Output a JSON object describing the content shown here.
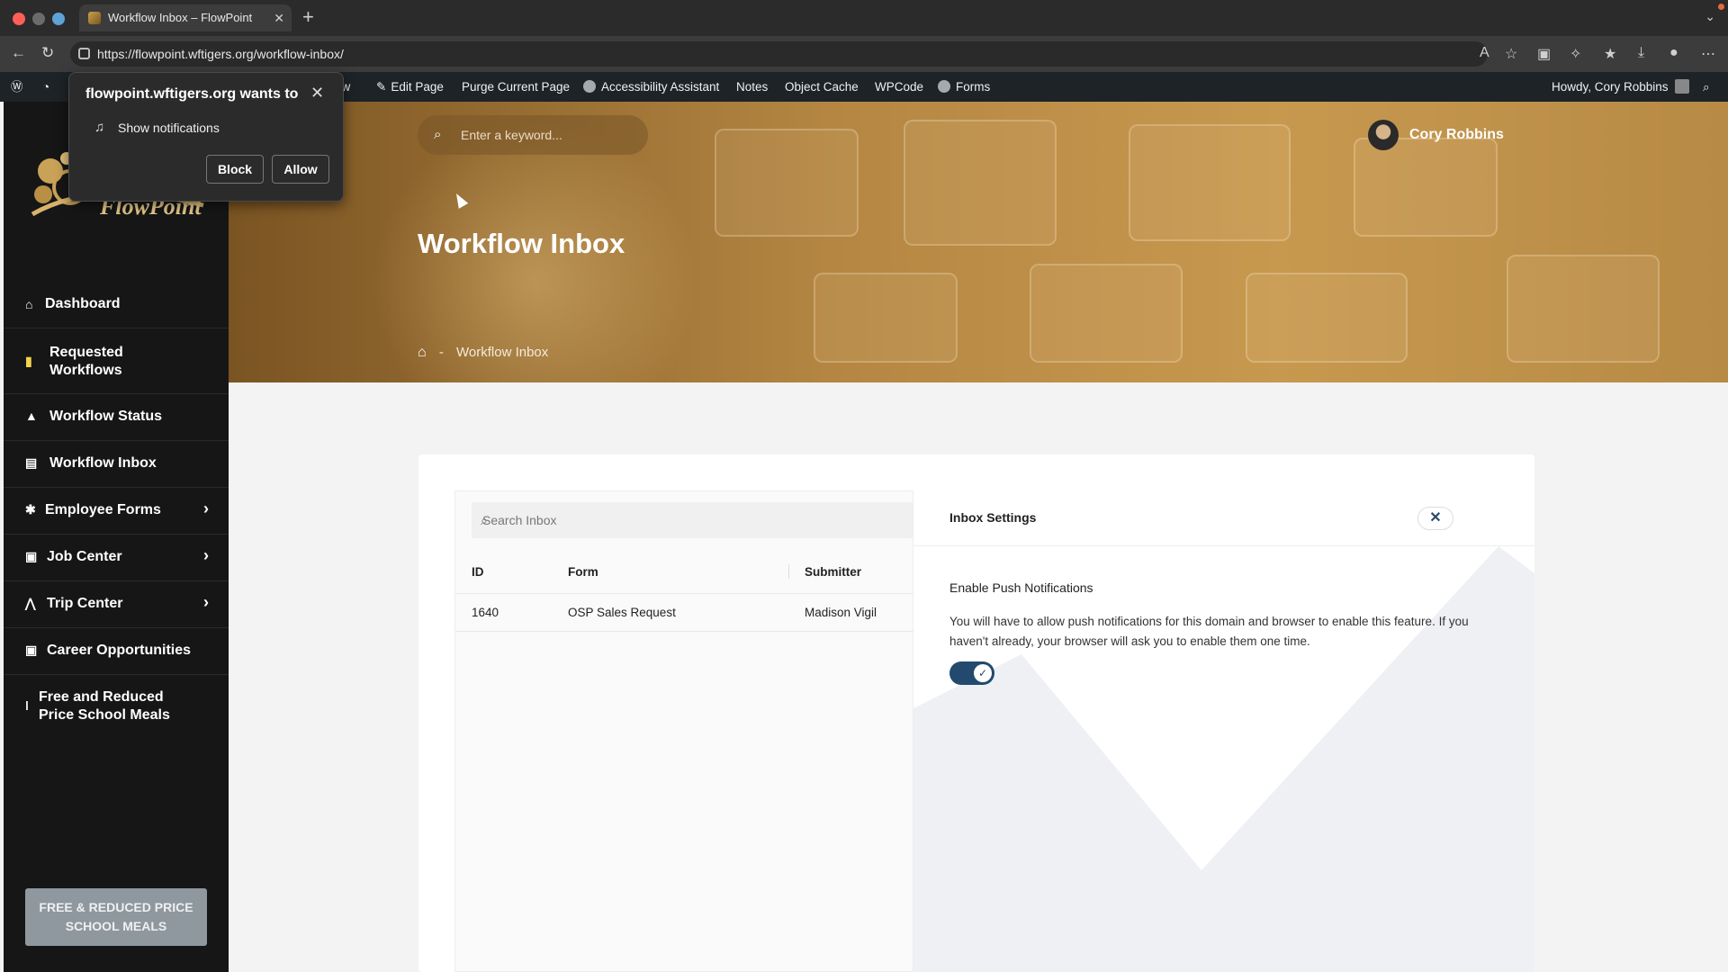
{
  "browser": {
    "tab_title": "Workflow Inbox – FlowPoint",
    "tab_close": "✕",
    "new_tab": "+",
    "url": "https://flowpoint.wftigers.org/workflow-inbox/"
  },
  "adminbar": {
    "items": [
      "ew",
      "Edit Page",
      "Purge Current Page",
      "Accessibility Assistant",
      "Notes",
      "Object Cache",
      "WPCode",
      "Forms"
    ],
    "howdy": "Howdy, Cory Robbins"
  },
  "permission_popup": {
    "title": "flowpoint.wftigers.org wants to",
    "item": "Show notifications",
    "block": "Block",
    "allow": "Allow",
    "close": "✕"
  },
  "sidebar": {
    "logo_text": "FlowPoint",
    "items": [
      {
        "label": "Dashboard",
        "icon": "home-icon"
      },
      {
        "label": "Requested Workflows",
        "icon": "clipboard-icon"
      },
      {
        "label": "Workflow Status",
        "icon": "chart-icon"
      },
      {
        "label": "Workflow Inbox",
        "icon": "inbox-icon"
      },
      {
        "label": "Employee Forms",
        "icon": "people-icon"
      },
      {
        "label": "Job Center",
        "icon": "briefcase-icon"
      },
      {
        "label": "Trip Center",
        "icon": "road-icon"
      },
      {
        "label": "Career Opportunities",
        "icon": "briefcase-icon"
      },
      {
        "label": "Free and Reduced Price School Meals",
        "icon": "spoon-icon"
      }
    ],
    "button": "FREE & REDUCED PRICE SCHOOL MEALS"
  },
  "hero": {
    "search_placeholder": "Enter a keyword...",
    "user_name": "Cory Robbins",
    "title": "Workflow Inbox",
    "breadcrumb_sep": "-",
    "breadcrumb_current": "Workflow Inbox"
  },
  "inbox": {
    "search_placeholder": "Search Inbox",
    "columns": [
      "ID",
      "Form",
      "Submitter"
    ],
    "rows": [
      {
        "id": "1640",
        "form": "OSP Sales Request",
        "submitter": "Madison Vigil"
      }
    ]
  },
  "settings": {
    "title": "Inbox Settings",
    "close": "✕",
    "push_title": "Enable Push Notifications",
    "push_desc": "You will have to allow push notifications for this domain and browser to enable this feature. If you haven't already, your browser will ask you to enable them one time.",
    "push_enabled": true
  },
  "colors": {
    "sidebar_bg": "#161616",
    "accent": "#234a6e",
    "hero_gold": "#b48642"
  }
}
